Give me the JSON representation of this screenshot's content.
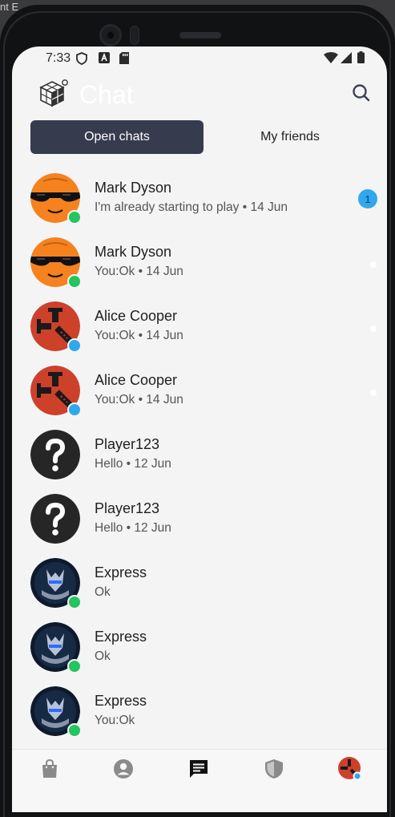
{
  "window": {
    "title_fragment": "nt E"
  },
  "statusbar": {
    "time": "7:33"
  },
  "appbar": {
    "title": "Chat",
    "search_icon": "search-icon"
  },
  "tabs": [
    {
      "label": "Open chats",
      "active": true
    },
    {
      "label": "My friends",
      "active": false
    }
  ],
  "chats": [
    {
      "name": "Mark Dyson",
      "preview": "I'm already starting to play • 14 Jun",
      "avatar": "sunglasses-face",
      "presence": "online",
      "unread": "1"
    },
    {
      "name": "Mark Dyson",
      "preview": "You:Ok • 14 Jun",
      "avatar": "sunglasses-face",
      "presence": "online",
      "unread": ""
    },
    {
      "name": "Alice Cooper",
      "preview": "You:Ok • 14 Jun",
      "avatar": "rust-logo",
      "presence": "away",
      "unread": ""
    },
    {
      "name": "Alice Cooper",
      "preview": "You:Ok • 14 Jun",
      "avatar": "rust-logo",
      "presence": "away",
      "unread": ""
    },
    {
      "name": "Player123",
      "preview": "Hello • 12 Jun",
      "avatar": "question-mark",
      "presence": "none",
      "unread": ""
    },
    {
      "name": "Player123",
      "preview": "Hello • 12 Jun",
      "avatar": "question-mark",
      "presence": "none",
      "unread": ""
    },
    {
      "name": "Express",
      "preview": "Ok",
      "avatar": "wolf-logo",
      "presence": "online",
      "unread": ""
    },
    {
      "name": "Express",
      "preview": "Ok",
      "avatar": "wolf-logo",
      "presence": "online",
      "unread": ""
    },
    {
      "name": "Express",
      "preview": "You:Ok",
      "avatar": "wolf-logo",
      "presence": "online",
      "unread": ""
    }
  ],
  "bottom_nav": [
    {
      "name": "shopping-bag-icon",
      "active": false
    },
    {
      "name": "account-icon",
      "active": false
    },
    {
      "name": "chat-icon",
      "active": true
    },
    {
      "name": "shield-icon",
      "active": false
    },
    {
      "name": "profile-avatar",
      "active": false
    }
  ],
  "colors": {
    "tab_active_bg": "#363b4e",
    "online": "#22c55e",
    "away": "#2fa8ee",
    "badge": "#2fa8ee",
    "screen_bg": "#f4f4f4"
  }
}
